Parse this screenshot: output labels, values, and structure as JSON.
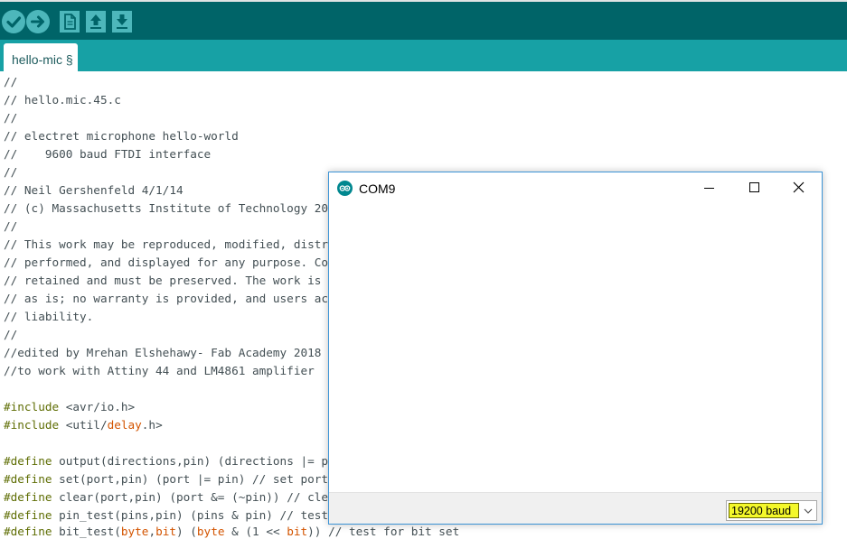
{
  "toolbar": {
    "buttons": [
      {
        "icon": "verify-check-icon"
      },
      {
        "icon": "upload-arrow-icon"
      },
      {
        "icon": "new-file-icon"
      },
      {
        "icon": "open-arrow-up-icon"
      },
      {
        "icon": "save-arrow-down-icon"
      }
    ]
  },
  "tab": {
    "label": "hello-mic §"
  },
  "editor": {
    "lines": [
      {
        "text": "//"
      },
      {
        "text": "// hello.mic.45.c"
      },
      {
        "text": "//"
      },
      {
        "text": "// electret microphone hello-world"
      },
      {
        "text": "//    9600 baud FTDI interface"
      },
      {
        "text": "//"
      },
      {
        "text": "// Neil Gershenfeld 4/1/14"
      },
      {
        "text": "// (c) Massachusetts Institute of Technology 20"
      },
      {
        "text": "//"
      },
      {
        "text": "// This work may be reproduced, modified, distr"
      },
      {
        "text": "// performed, and displayed for any purpose. Co"
      },
      {
        "text": "// retained and must be preserved. The work is"
      },
      {
        "text": "// as is; no warranty is provided, and users ac"
      },
      {
        "text": "// liability."
      },
      {
        "text": "//"
      },
      {
        "text": "//edited by Mrehan Elshehawy- Fab Academy 2018"
      },
      {
        "text": "//to work with Attiny 44 and LM4861 amplifier"
      },
      {
        "text": ""
      },
      {
        "directive": "#include",
        "a": " <avr/io.h>"
      },
      {
        "directive": "#include",
        "a": " <util/",
        "t": "delay",
        "b": ".h>"
      },
      {
        "text": ""
      },
      {
        "directive": "#define",
        "a": " output(directions,pin) (directions |= p"
      },
      {
        "directive": "#define",
        "a": " set(port,pin) (port |= pin) // set port"
      },
      {
        "directive": "#define",
        "a": " clear(port,pin) (port &= (~pin)) // cle"
      },
      {
        "directive": "#define",
        "a": " pin_test(pins,pin) (pins & pin) // test"
      },
      {
        "directive": "#define",
        "a": " bit_test(",
        "t": "byte",
        "b": ",",
        "t2": "bit",
        "c": ") (",
        "t3": "byte",
        "d": " & (1 << ",
        "t4": "bit",
        "e": ")) // test for bit set"
      }
    ]
  },
  "serial_monitor": {
    "title": "COM9",
    "logo_icon": "arduino-logo-icon",
    "controls": {
      "minimize_icon": "minimize-icon",
      "maximize_icon": "maximize-icon",
      "close_icon": "close-icon"
    },
    "baud_rate": "19200 baud"
  }
}
